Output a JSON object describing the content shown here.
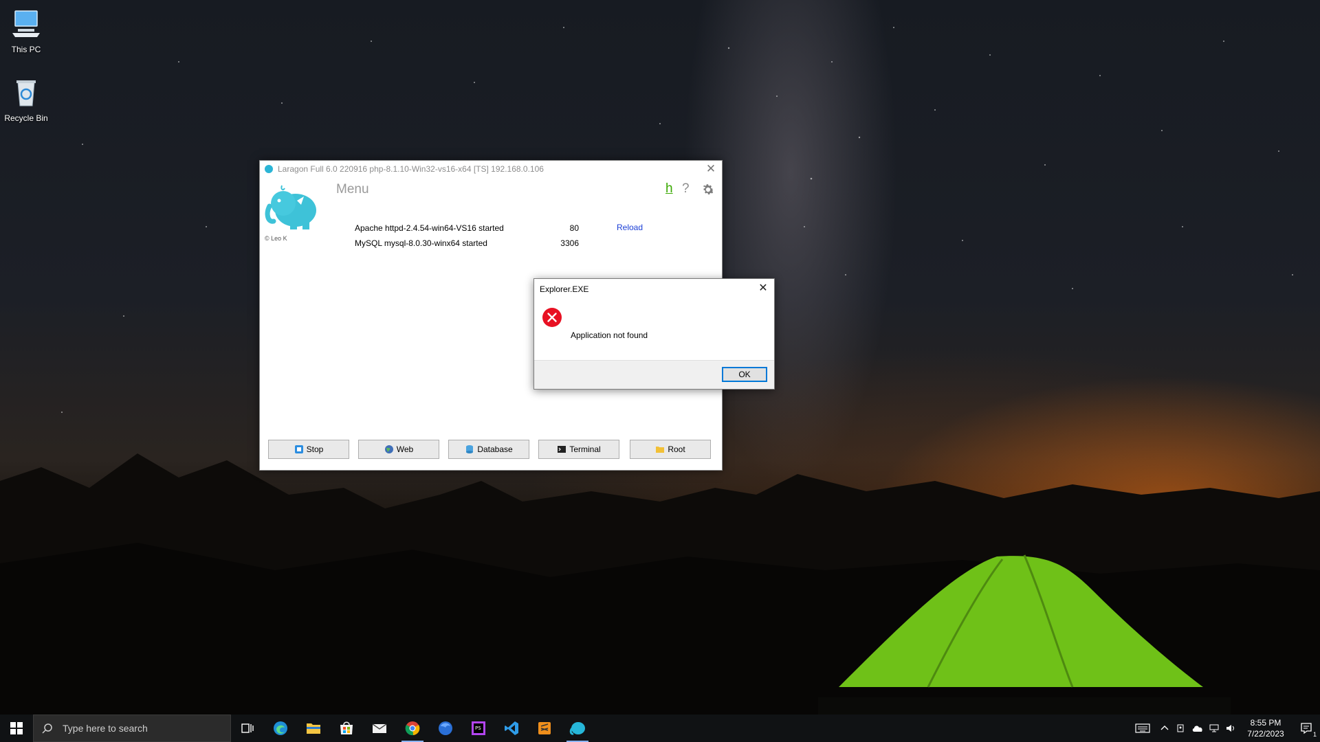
{
  "desktop": {
    "icons": [
      {
        "label": "This PC",
        "icon": "this-pc-icon"
      },
      {
        "label": "Recycle Bin",
        "icon": "recycle-bin-icon"
      }
    ]
  },
  "laragon": {
    "title": "Laragon Full 6.0 220916 php-8.1.10-Win32-vs16-x64 [TS]  192.168.0.106",
    "copyright": "© Leo K",
    "menu_label": "Menu",
    "h_label": "h",
    "help_label": "?",
    "services": [
      {
        "name": "Apache httpd-2.4.54-win64-VS16 started",
        "port": "80",
        "action": "Reload"
      },
      {
        "name": "MySQL mysql-8.0.30-winx64 started",
        "port": "3306"
      }
    ],
    "buttons": [
      {
        "label": "Stop",
        "icon": "stop-icon"
      },
      {
        "label": "Web",
        "icon": "globe-icon"
      },
      {
        "label": "Database",
        "icon": "database-icon"
      },
      {
        "label": "Terminal",
        "icon": "terminal-icon"
      },
      {
        "label": "Root",
        "icon": "folder-icon"
      }
    ]
  },
  "dialog": {
    "title": "Explorer.EXE",
    "message": "Application not found",
    "ok_label": "OK",
    "icon": "error-icon"
  },
  "taskbar": {
    "search_placeholder": "Type here to search",
    "apps": [
      "task-view-icon",
      "edge-icon",
      "file-explorer-icon",
      "store-icon",
      "mail-icon",
      "chrome-icon",
      "firefox-icon",
      "phpstorm-icon",
      "vscode-icon",
      "sublime-icon",
      "laragon-icon"
    ],
    "time": "8:55 PM",
    "date": "7/22/2023",
    "notification_count": "1"
  },
  "colors": {
    "accent": "#0078d7",
    "link": "#1a3ed6",
    "error": "#e81123",
    "h_green": "#39a800"
  }
}
